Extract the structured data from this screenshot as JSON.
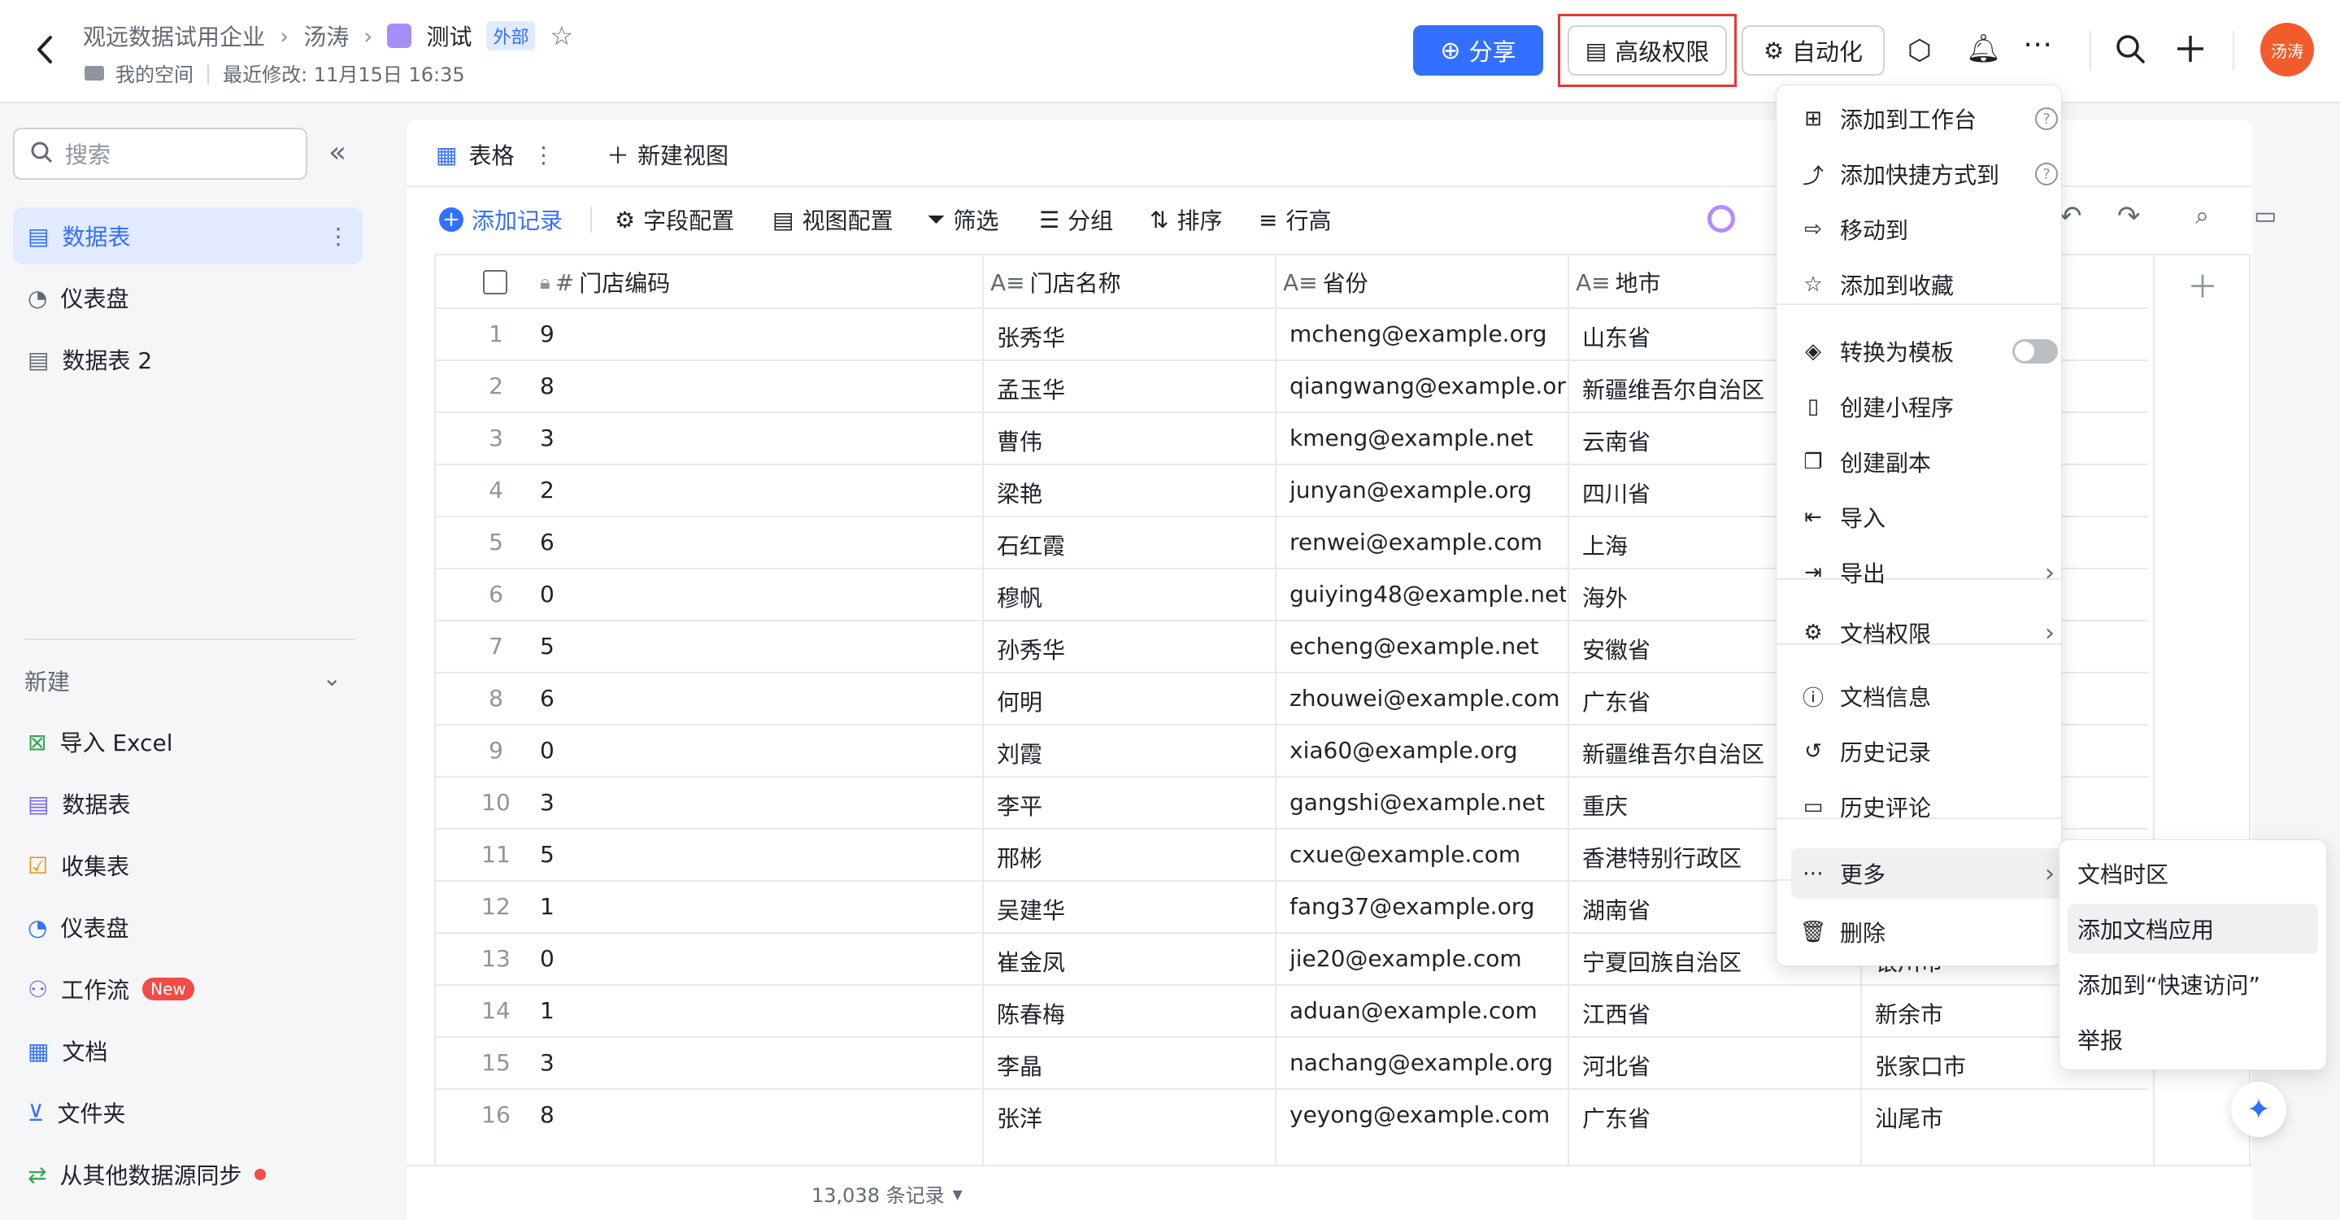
{
  "header": {
    "breadcrumb": [
      "观远数据试用企业",
      "汤涛",
      "测试"
    ],
    "badge": "外部",
    "sub_location": "我的空间",
    "last_modified": "最近修改: 11月15日 16:35",
    "share_label": "分享",
    "advanced_perm_label": "高级权限",
    "automation_label": "自动化",
    "avatar_text": "汤涛",
    "accent": "#3370ff"
  },
  "sidebar": {
    "search_placeholder": "搜索",
    "tables": [
      {
        "label": "数据表",
        "icon": "table-icon",
        "active": true
      },
      {
        "label": "仪表盘",
        "icon": "dashboard-icon"
      },
      {
        "label": "数据表 2",
        "icon": "table-icon"
      }
    ],
    "new_section": "新建",
    "new_items": [
      {
        "label": "导入 Excel",
        "icon": "excel-icon",
        "color": "#34a853"
      },
      {
        "label": "数据表",
        "icon": "table-icon",
        "color": "#7b61ff"
      },
      {
        "label": "收集表",
        "icon": "form-icon",
        "color": "#ff8800"
      },
      {
        "label": "仪表盘",
        "icon": "dashboard-icon",
        "color": "#3370ff"
      },
      {
        "label": "工作流",
        "icon": "workflow-icon",
        "color": "#7b61ff",
        "badge": "New"
      },
      {
        "label": "文档",
        "icon": "doc-icon",
        "color": "#3370ff"
      },
      {
        "label": "文件夹",
        "icon": "folder-icon",
        "color": "#3370ff"
      },
      {
        "label": "从其他数据源同步",
        "icon": "sync-icon",
        "color": "#34a853"
      }
    ]
  },
  "views": {
    "tab_label": "表格",
    "new_view_label": "新建视图"
  },
  "toolbar": {
    "add_record": "添加记录",
    "field_config": "字段配置",
    "view_config": "视图配置",
    "filter": "筛选",
    "group": "分组",
    "sort": "排序",
    "row_height": "行高"
  },
  "table": {
    "columns": [
      "门店编码",
      "门店名称",
      "省份",
      "地市"
    ],
    "rows": [
      [
        "1",
        "9",
        "张秀华",
        "mcheng@example.org",
        "山东省",
        ""
      ],
      [
        "2",
        "8",
        "孟玉华",
        "qiangwang@example.org",
        "新疆维吾尔自治区",
        ""
      ],
      [
        "3",
        "3",
        "曹伟",
        "kmeng@example.net",
        "云南省",
        ""
      ],
      [
        "4",
        "2",
        "梁艳",
        "junyan@example.org",
        "四川省",
        ""
      ],
      [
        "5",
        "6",
        "石红霞",
        "renwei@example.com",
        "上海",
        ""
      ],
      [
        "6",
        "0",
        "穆帆",
        "guiying48@example.net",
        "海外",
        ""
      ],
      [
        "7",
        "5",
        "孙秀华",
        "echeng@example.net",
        "安徽省",
        ""
      ],
      [
        "8",
        "6",
        "何明",
        "zhouwei@example.com",
        "广东省",
        ""
      ],
      [
        "9",
        "0",
        "刘霞",
        "xia60@example.org",
        "新疆维吾尔自治区",
        ""
      ],
      [
        "10",
        "3",
        "李平",
        "gangshi@example.net",
        "重庆",
        ""
      ],
      [
        "11",
        "5",
        "邢彬",
        "cxue@example.com",
        "香港特别行政区",
        ""
      ],
      [
        "12",
        "1",
        "吴建华",
        "fang37@example.org",
        "湖南省",
        ""
      ],
      [
        "13",
        "0",
        "崔金凤",
        "jie20@example.com",
        "宁夏回族自治区",
        "银川市"
      ],
      [
        "14",
        "1",
        "陈春梅",
        "aduan@example.com",
        "江西省",
        "新余市"
      ],
      [
        "15",
        "3",
        "李晶",
        "nachang@example.org",
        "河北省",
        "张家口市"
      ],
      [
        "16",
        "8",
        "张洋",
        "yeyong@example.com",
        "广东省",
        "汕尾市"
      ]
    ],
    "record_count": "13,038 条记录"
  },
  "menu": {
    "items": [
      {
        "label": "添加到工作台",
        "icon": "workspace-icon",
        "help": true
      },
      {
        "label": "添加快捷方式到",
        "icon": "shortcut-icon",
        "help": true
      },
      {
        "label": "移动到",
        "icon": "move-icon"
      },
      {
        "label": "添加到收藏",
        "icon": "star-icon"
      },
      {
        "label": "转换为模板",
        "icon": "template-icon",
        "toggle": true
      },
      {
        "label": "创建小程序",
        "icon": "miniapp-icon"
      },
      {
        "label": "创建副本",
        "icon": "copy-icon"
      },
      {
        "label": "导入",
        "icon": "import-icon"
      },
      {
        "label": "导出",
        "icon": "export-icon",
        "submenu": true
      },
      {
        "label": "文档权限",
        "icon": "gear-icon",
        "submenu": true
      },
      {
        "label": "文档信息",
        "icon": "info-icon"
      },
      {
        "label": "历史记录",
        "icon": "history-icon"
      },
      {
        "label": "历史评论",
        "icon": "comment-history-icon"
      },
      {
        "label": "更多",
        "icon": "more-icon",
        "submenu": true,
        "active": true
      },
      {
        "label": "删除",
        "icon": "trash-icon"
      }
    ]
  },
  "submenu": {
    "items": [
      "文档时区",
      "添加文档应用",
      "添加到“快速访问”",
      "举报"
    ]
  }
}
